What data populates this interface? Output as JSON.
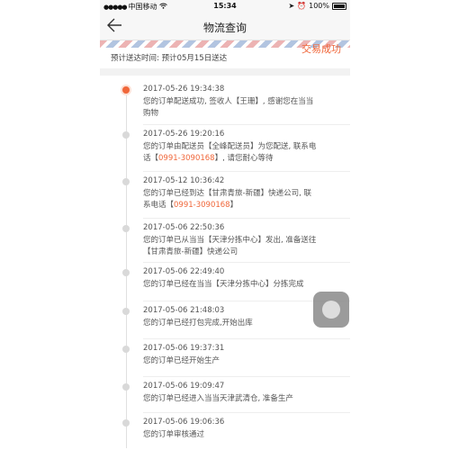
{
  "statusbar": {
    "carrier": "中国移动",
    "time": "15:34",
    "battery": "100%"
  },
  "navbar": {
    "title": "物流查询",
    "back_icon": "back-arrow-icon"
  },
  "order": {
    "status": "交易成功",
    "eta_label": "预计送达时间:",
    "eta_value": "预计05月15日送达"
  },
  "timeline": [
    {
      "time": "2017-05-26 19:34:38",
      "lines": [
        "您的订单配送成功, 签收人【王珊】, 感谢您在当当",
        "购物"
      ],
      "current": true
    },
    {
      "time": "2017-05-26 19:20:16",
      "lines": [
        "您的订单由配送员【全峰配送员】为您配送, 联系电",
        "话【",
        "0991-3090168",
        "】, 请您耐心等待"
      ]
    },
    {
      "time": "2017-05-12 10:36:42",
      "lines": [
        "您的订单已经到达【甘肃青旅-新疆】快递公司, 联",
        "系电话【",
        "0991-3090168",
        "】"
      ]
    },
    {
      "time": "2017-05-06 22:50:36",
      "lines": [
        "您的订单已从当当【天津分拣中心】发出, 准备送往",
        "【甘肃青旅-新疆】快递公司"
      ]
    },
    {
      "time": "2017-05-06 22:49:40",
      "lines": [
        "您的订单已经在当当【天津分拣中心】分拣完成"
      ]
    },
    {
      "time": "2017-05-06 21:48:03",
      "lines": [
        "您的订单已经打包完成,开始出库"
      ]
    },
    {
      "time": "2017-05-06 19:37:31",
      "lines": [
        "您的订单已经开始生产"
      ]
    },
    {
      "time": "2017-05-06 19:09:47",
      "lines": [
        "您的订单已经进入当当天津武清仓, 准备生产"
      ]
    },
    {
      "time": "2017-05-06 19:06:36",
      "lines": [
        "您的订单审核通过"
      ]
    }
  ],
  "colors": {
    "accent": "#f0673a",
    "text": "#555555"
  }
}
